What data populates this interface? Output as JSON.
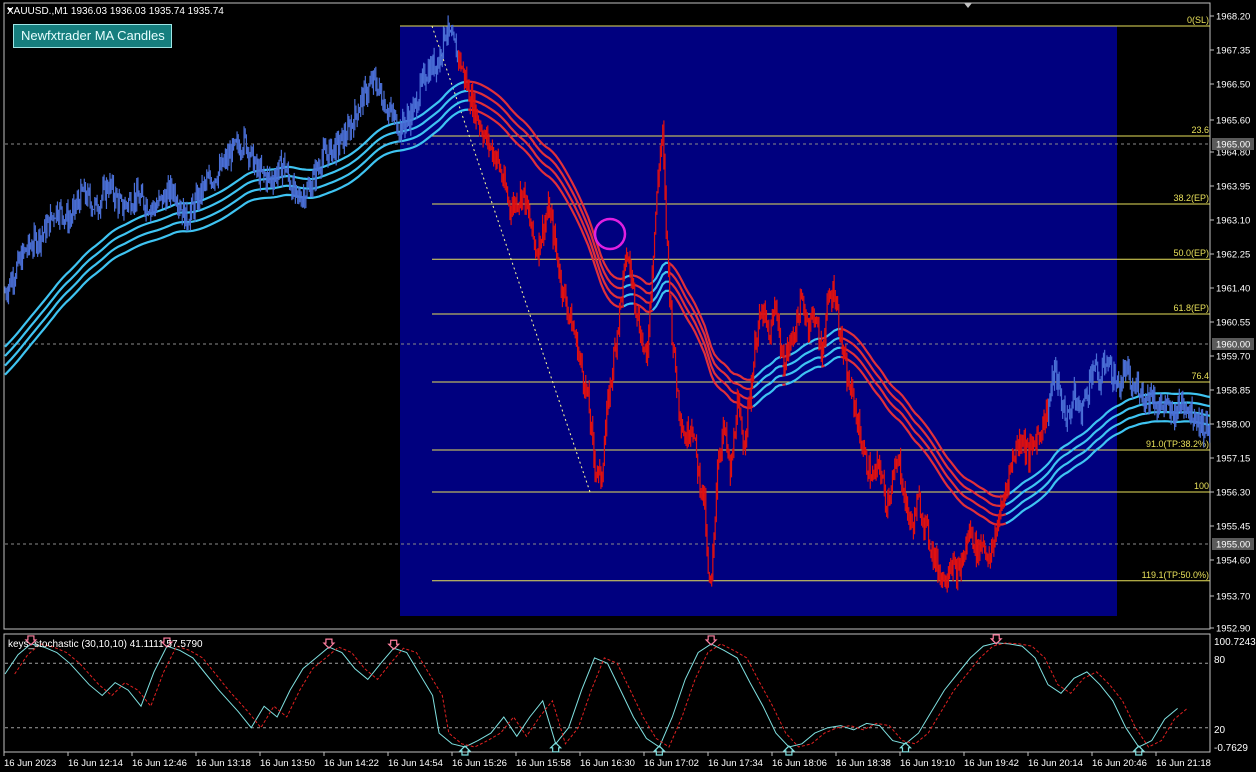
{
  "header": {
    "symbol_info": "XAUUSD.,M1  1936.03 1936.03 1935.74 1935.74",
    "indicator_button": "Newfxtrader MA Candles"
  },
  "subwindow": {
    "title": "keys_stochastic (30,10,10) 41.1111 57.5790",
    "max_label": "100.7243",
    "level_high": "80",
    "level_low": "20",
    "min_label": "-0.7629"
  },
  "colors": {
    "background": "#000000",
    "fib_zone": "#00007f",
    "bull_candles": "#4a6fd6",
    "bear_candles": "#e01010",
    "ma_bull": "#3fc4f2",
    "ma_bear": "#e0303a",
    "fib_lines": "#e8e05a",
    "stoch_main": "#7fe0e0",
    "stoch_signal": "#e02020",
    "arrow_up": "#7fe0e0",
    "arrow_down": "#ff7fa0"
  },
  "chart_data": {
    "type": "candlestick",
    "symbol": "XAUUSD.",
    "timeframe": "M1",
    "price_axis": {
      "ylim": [
        1952.9,
        1968.5
      ],
      "ticks": [
        "1968.20",
        "1967.35",
        "1966.50",
        "1965.60",
        "1964.80",
        "1963.95",
        "1963.10",
        "1962.25",
        "1961.40",
        "1960.55",
        "1959.70",
        "1958.85",
        "1958.00",
        "1957.15",
        "1956.30",
        "1955.45",
        "1954.60",
        "1953.70",
        "1952.90"
      ],
      "tick_values": [
        1968.2,
        1967.35,
        1966.5,
        1965.6,
        1964.8,
        1963.95,
        1963.1,
        1962.25,
        1961.4,
        1960.55,
        1959.7,
        1958.85,
        1958.0,
        1957.15,
        1956.3,
        1955.45,
        1954.6,
        1953.7,
        1952.9
      ],
      "highlight_levels": [
        {
          "label": "1965.00",
          "value": 1965.0
        },
        {
          "label": "1960.00",
          "value": 1960.0
        },
        {
          "label": "1955.00",
          "value": 1955.0
        }
      ]
    },
    "time_axis": {
      "labels": [
        "16 Jun 2023",
        "16 Jun 12:14",
        "16 Jun 12:46",
        "16 Jun 13:18",
        "16 Jun 13:50",
        "16 Jun 14:22",
        "16 Jun 14:54",
        "16 Jun 15:26",
        "16 Jun 15:58",
        "16 Jun 16:30",
        "16 Jun 17:02",
        "16 Jun 17:34",
        "16 Jun 18:06",
        "16 Jun 18:38",
        "16 Jun 19:10",
        "16 Jun 19:42",
        "16 Jun 20:14",
        "16 Jun 20:46",
        "16 Jun 21:18"
      ]
    },
    "fibonacci": {
      "high_price": 1967.95,
      "low_price": 1956.3,
      "levels": [
        {
          "label": "0(SL)",
          "price": 1967.95
        },
        {
          "label": "23.6",
          "price": 1965.2
        },
        {
          "label": "38.2(EP)",
          "price": 1963.5
        },
        {
          "label": "50.0(EP)",
          "price": 1962.12
        },
        {
          "label": "61.8(EP)",
          "price": 1960.75
        },
        {
          "label": "76.4",
          "price": 1959.05
        },
        {
          "label": "91.0(TP:38.2%)",
          "price": 1957.35
        },
        {
          "label": "100",
          "price": 1956.3
        },
        {
          "label": "119.1(TP:50.0%)",
          "price": 1954.08
        }
      ]
    },
    "price_path": [
      [
        0,
        1961.3
      ],
      [
        3,
        1962.3
      ],
      [
        6,
        1962.8
      ],
      [
        8,
        1963.4
      ],
      [
        10,
        1963.1
      ],
      [
        12,
        1963.8
      ],
      [
        14,
        1963.4
      ],
      [
        16,
        1964.0
      ],
      [
        18,
        1963.4
      ],
      [
        20,
        1963.7
      ],
      [
        23,
        1963.4
      ],
      [
        26,
        1963.9
      ],
      [
        28,
        1963.1
      ],
      [
        31,
        1964.0
      ],
      [
        33,
        1964.3
      ],
      [
        35,
        1964.8
      ],
      [
        37,
        1965.1
      ],
      [
        39,
        1964.3
      ],
      [
        41,
        1964.1
      ],
      [
        43,
        1964.5
      ],
      [
        45,
        1963.6
      ],
      [
        47,
        1963.9
      ],
      [
        49,
        1964.7
      ],
      [
        51,
        1964.9
      ],
      [
        53,
        1965.3
      ],
      [
        55,
        1966.1
      ],
      [
        57,
        1966.6
      ],
      [
        59,
        1965.9
      ],
      [
        61,
        1965.4
      ],
      [
        63,
        1965.8
      ],
      [
        65,
        1966.8
      ],
      [
        67,
        1967.1
      ],
      [
        68,
        1967.9
      ],
      [
        70,
        1967.2
      ],
      [
        72,
        1966.1
      ],
      [
        74,
        1965.2
      ],
      [
        76,
        1964.6
      ],
      [
        78,
        1963.4
      ],
      [
        80,
        1963.8
      ],
      [
        82,
        1962.3
      ],
      [
        84,
        1963.4
      ],
      [
        86,
        1961.4
      ],
      [
        88,
        1960.2
      ],
      [
        90,
        1958.6
      ],
      [
        91,
        1957.0
      ],
      [
        92,
        1956.6
      ],
      [
        93,
        1958.4
      ],
      [
        95,
        1961.0
      ],
      [
        96,
        1962.3
      ],
      [
        97,
        1961.4
      ],
      [
        98,
        1960.4
      ],
      [
        99,
        1959.5
      ],
      [
        100,
        1962.2
      ],
      [
        101,
        1964.6
      ],
      [
        101.5,
        1965.3
      ],
      [
        102,
        1963.1
      ],
      [
        103,
        1960.2
      ],
      [
        104,
        1958.5
      ],
      [
        105,
        1957.6
      ],
      [
        106,
        1958.1
      ],
      [
        107,
        1956.8
      ],
      [
        108,
        1956.0
      ],
      [
        108.5,
        1954.2
      ],
      [
        109,
        1953.8
      ],
      [
        110,
        1957.1
      ],
      [
        111,
        1957.9
      ],
      [
        112,
        1956.7
      ],
      [
        113,
        1958.5
      ],
      [
        114,
        1957.5
      ],
      [
        115,
        1958.7
      ],
      [
        116,
        1960.3
      ],
      [
        117,
        1960.8
      ],
      [
        118,
        1960.1
      ],
      [
        119,
        1961.1
      ],
      [
        120,
        1959.5
      ],
      [
        121,
        1959.9
      ],
      [
        122,
        1960.4
      ],
      [
        123,
        1961.1
      ],
      [
        124,
        1960.5
      ],
      [
        125,
        1960.8
      ],
      [
        126,
        1959.7
      ],
      [
        127,
        1961.0
      ],
      [
        128,
        1961.4
      ],
      [
        129,
        1960.2
      ],
      [
        130,
        1959.1
      ],
      [
        131,
        1958.6
      ],
      [
        132,
        1957.7
      ],
      [
        133,
        1957.0
      ],
      [
        134,
        1956.6
      ],
      [
        135,
        1957.0
      ],
      [
        136,
        1956.0
      ],
      [
        137,
        1956.6
      ],
      [
        138,
        1957.1
      ],
      [
        139,
        1956.0
      ],
      [
        140,
        1955.4
      ],
      [
        141,
        1956.1
      ],
      [
        142,
        1955.5
      ],
      [
        143,
        1954.9
      ],
      [
        144,
        1954.4
      ],
      [
        145,
        1954.1
      ],
      [
        146,
        1954.6
      ],
      [
        147,
        1954.2
      ],
      [
        148,
        1954.7
      ],
      [
        149,
        1955.4
      ],
      [
        150,
        1954.8
      ],
      [
        151,
        1955.1
      ],
      [
        152,
        1954.5
      ],
      [
        153,
        1955.4
      ],
      [
        154,
        1956.0
      ],
      [
        155,
        1956.8
      ],
      [
        156,
        1957.4
      ],
      [
        157,
        1957.7
      ],
      [
        158,
        1957.2
      ],
      [
        159,
        1957.6
      ],
      [
        160,
        1957.9
      ],
      [
        161,
        1958.4
      ],
      [
        162,
        1959.4
      ],
      [
        163,
        1958.6
      ],
      [
        164,
        1958.1
      ],
      [
        165,
        1958.7
      ],
      [
        166,
        1958.3
      ],
      [
        167,
        1958.8
      ],
      [
        168,
        1959.5
      ],
      [
        169,
        1959.0
      ],
      [
        170,
        1959.7
      ],
      [
        171,
        1959.2
      ],
      [
        172,
        1958.9
      ],
      [
        173,
        1959.4
      ],
      [
        174,
        1958.8
      ],
      [
        175,
        1959.0
      ],
      [
        176,
        1958.6
      ],
      [
        177,
        1958.8
      ],
      [
        178,
        1958.4
      ],
      [
        179,
        1958.5
      ],
      [
        180,
        1958.2
      ],
      [
        181,
        1958.4
      ],
      [
        182,
        1958.6
      ],
      [
        183,
        1958.3
      ],
      [
        184,
        1958.2
      ],
      [
        185,
        1957.9
      ],
      [
        186,
        1958.0
      ]
    ],
    "stochastic_path": [
      [
        0,
        70
      ],
      [
        2,
        88
      ],
      [
        4,
        98
      ],
      [
        6,
        95
      ],
      [
        8,
        90
      ],
      [
        10,
        80
      ],
      [
        13,
        60
      ],
      [
        15,
        50
      ],
      [
        17,
        62
      ],
      [
        19,
        55
      ],
      [
        21,
        40
      ],
      [
        23,
        72
      ],
      [
        25,
        96
      ],
      [
        27,
        92
      ],
      [
        29,
        85
      ],
      [
        31,
        70
      ],
      [
        33,
        55
      ],
      [
        36,
        35
      ],
      [
        38,
        20
      ],
      [
        40,
        40
      ],
      [
        42,
        30
      ],
      [
        44,
        55
      ],
      [
        46,
        75
      ],
      [
        48,
        85
      ],
      [
        50,
        95
      ],
      [
        52,
        90
      ],
      [
        54,
        75
      ],
      [
        56,
        65
      ],
      [
        58,
        80
      ],
      [
        60,
        94
      ],
      [
        62,
        90
      ],
      [
        64,
        70
      ],
      [
        66,
        50
      ],
      [
        67,
        15
      ],
      [
        69,
        5
      ],
      [
        71,
        2
      ],
      [
        73,
        8
      ],
      [
        75,
        15
      ],
      [
        77,
        30
      ],
      [
        79,
        12
      ],
      [
        81,
        30
      ],
      [
        83,
        45
      ],
      [
        85,
        5
      ],
      [
        87,
        20
      ],
      [
        89,
        55
      ],
      [
        91,
        85
      ],
      [
        93,
        80
      ],
      [
        95,
        55
      ],
      [
        97,
        30
      ],
      [
        99,
        10
      ],
      [
        101,
        2
      ],
      [
        103,
        30
      ],
      [
        105,
        65
      ],
      [
        107,
        90
      ],
      [
        109,
        98
      ],
      [
        111,
        92
      ],
      [
        113,
        85
      ],
      [
        115,
        62
      ],
      [
        117,
        40
      ],
      [
        119,
        15
      ],
      [
        121,
        2
      ],
      [
        123,
        5
      ],
      [
        125,
        15
      ],
      [
        127,
        20
      ],
      [
        129,
        22
      ],
      [
        131,
        18
      ],
      [
        133,
        24
      ],
      [
        135,
        22
      ],
      [
        137,
        8
      ],
      [
        139,
        5
      ],
      [
        141,
        15
      ],
      [
        143,
        35
      ],
      [
        145,
        55
      ],
      [
        147,
        70
      ],
      [
        149,
        85
      ],
      [
        151,
        96
      ],
      [
        153,
        99
      ],
      [
        155,
        98
      ],
      [
        157,
        96
      ],
      [
        159,
        85
      ],
      [
        161,
        60
      ],
      [
        163,
        52
      ],
      [
        165,
        66
      ],
      [
        167,
        72
      ],
      [
        169,
        60
      ],
      [
        171,
        45
      ],
      [
        173,
        20
      ],
      [
        175,
        2
      ],
      [
        177,
        8
      ],
      [
        179,
        28
      ],
      [
        181,
        38
      ]
    ],
    "stochastic_signal_offset": 1.5
  }
}
